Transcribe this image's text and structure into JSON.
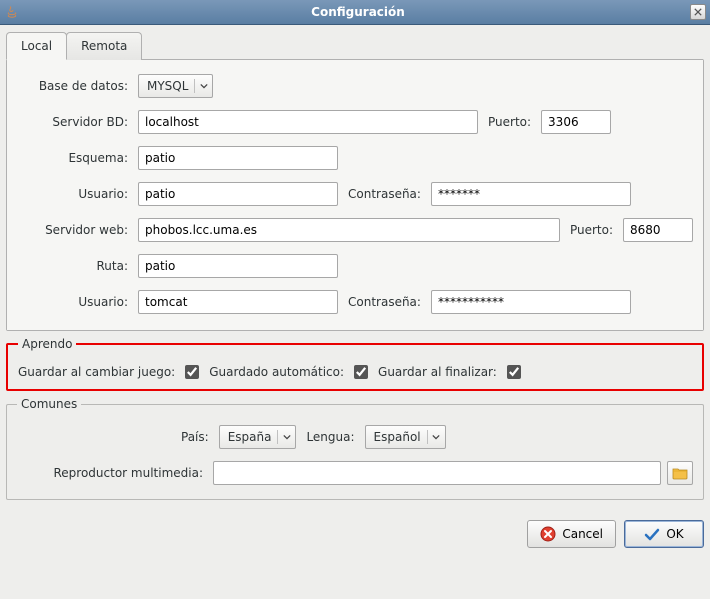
{
  "window": {
    "title": "Configuración"
  },
  "tabs": {
    "local": "Local",
    "remota": "Remota"
  },
  "db": {
    "base_label": "Base de datos:",
    "base_value": "MYSQL",
    "servidor_label": "Servidor BD:",
    "servidor_value": "localhost",
    "puerto_label": "Puerto:",
    "puerto_value": "3306",
    "esquema_label": "Esquema:",
    "esquema_value": "patio",
    "usuario_label": "Usuario:",
    "usuario_value": "patio",
    "contrasena_label": "Contraseña:",
    "contrasena_value": "*******"
  },
  "web": {
    "servidor_label": "Servidor web:",
    "servidor_value": "phobos.lcc.uma.es",
    "puerto_label": "Puerto:",
    "puerto_value": "8680",
    "ruta_label": "Ruta:",
    "ruta_value": "patio",
    "usuario_label": "Usuario:",
    "usuario_value": "tomcat",
    "contrasena_label": "Contraseña:",
    "contrasena_value": "***********"
  },
  "aprendo": {
    "legend": "Aprendo",
    "guardar_cambiar_label": "Guardar al cambiar juego:",
    "guardar_cambiar_checked": true,
    "guardado_auto_label": "Guardado automático:",
    "guardado_auto_checked": true,
    "guardar_finalizar_label": "Guardar al finalizar:",
    "guardar_finalizar_checked": true
  },
  "comunes": {
    "legend": "Comunes",
    "pais_label": "País:",
    "pais_value": "España",
    "lengua_label": "Lengua:",
    "lengua_value": "Español",
    "reproductor_label": "Reproductor multimedia:",
    "reproductor_value": ""
  },
  "footer": {
    "cancel": "Cancel",
    "ok": "OK"
  }
}
